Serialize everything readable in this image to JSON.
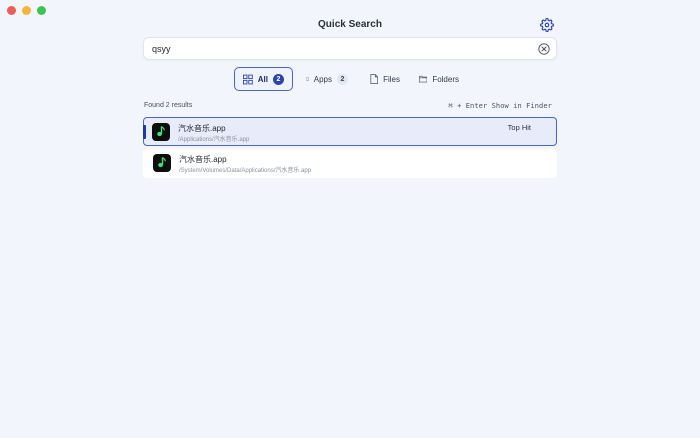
{
  "window": {
    "title": "Quick Search"
  },
  "search": {
    "value": "qsyy",
    "placeholder": ""
  },
  "filters": [
    {
      "label": "All",
      "count": "2",
      "active": true,
      "icon": "grid-icon"
    },
    {
      "label": "Apps",
      "count": "2",
      "active": false,
      "icon": "phone-icon"
    },
    {
      "label": "Files",
      "count": "",
      "active": false,
      "icon": "file-icon"
    },
    {
      "label": "Folders",
      "count": "",
      "active": false,
      "icon": "folder-icon"
    }
  ],
  "results_summary": {
    "count_text": "Found 2 results",
    "shortcut_text": "⌘ + Enter Show in Finder"
  },
  "results": [
    {
      "name": "汽水音乐.app",
      "path": "/Applications/汽水音乐.app",
      "tag": "Top Hit",
      "selected": true
    },
    {
      "name": "汽水音乐.app",
      "path": "/System/Volumes/Data/Applications/汽水音乐.app",
      "tag": "",
      "selected": false
    }
  ],
  "colors": {
    "accent": "#2d44a8",
    "app_icon_bg": "#0d0f0e",
    "app_icon_glyph": "#3fe07a"
  }
}
